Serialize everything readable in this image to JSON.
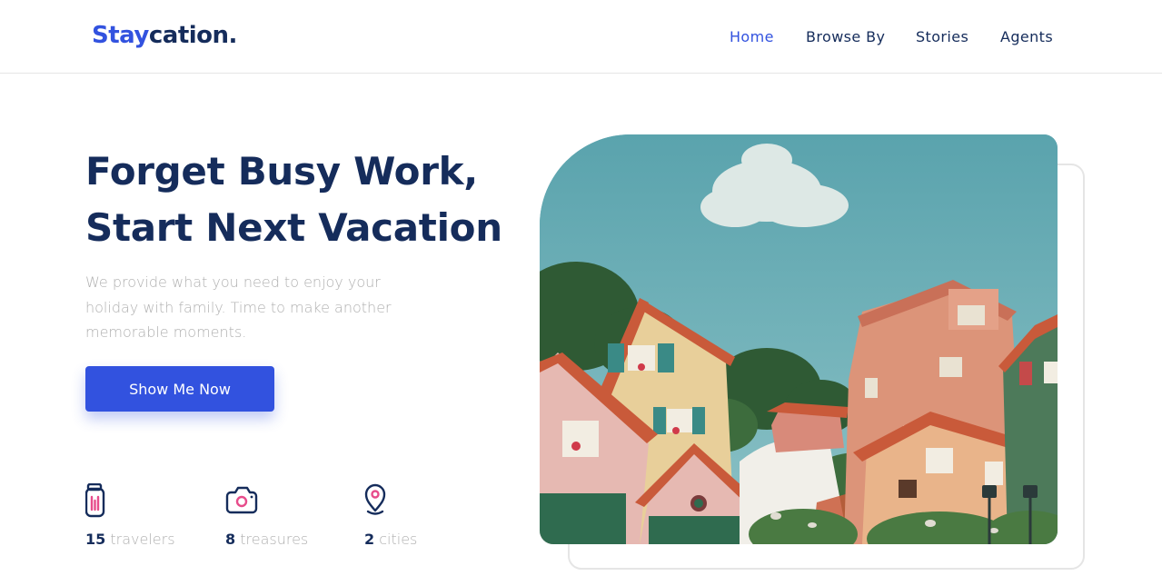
{
  "brand": {
    "accent": "Stay",
    "rest": "cation."
  },
  "nav": {
    "items": [
      {
        "label": "Home",
        "active": true
      },
      {
        "label": "Browse By",
        "active": false
      },
      {
        "label": "Stories",
        "active": false
      },
      {
        "label": "Agents",
        "active": false
      }
    ]
  },
  "hero": {
    "title_line1": "Forget Busy Work,",
    "title_line2": "Start Next Vacation",
    "description": "We provide what you need to enjoy your holiday with family. Time to make another memorable moments.",
    "cta_label": "Show Me Now",
    "image_alt": "Colorful houses under a blue sky"
  },
  "stats": [
    {
      "icon": "luggage-icon",
      "value": "15",
      "unit": "travelers"
    },
    {
      "icon": "camera-icon",
      "value": "8",
      "unit": "treasures"
    },
    {
      "icon": "location-pin-icon",
      "value": "2",
      "unit": "cities"
    }
  ],
  "colors": {
    "primary": "#3252df",
    "navy": "#152c5b",
    "muted": "#b0b0b0",
    "accent_pink": "#e74c8b",
    "border": "#e5e5e5"
  }
}
